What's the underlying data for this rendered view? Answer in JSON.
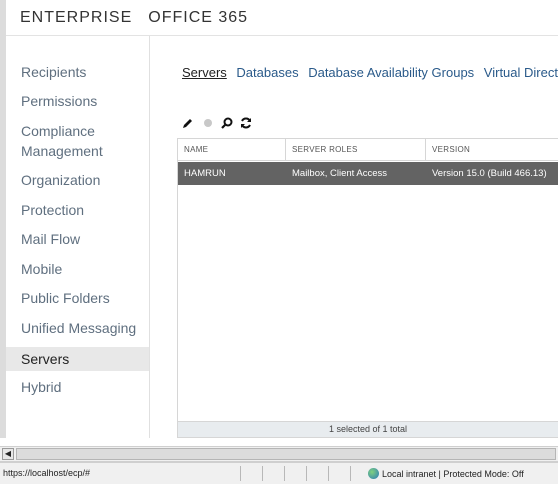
{
  "header": {
    "brand_1": "ENTERPRISE",
    "brand_2": "OFFICE 365"
  },
  "sidebar": {
    "items": [
      {
        "label": "Recipients"
      },
      {
        "label": "Permissions"
      },
      {
        "label": "Compliance\nManagement"
      },
      {
        "label": "Organization"
      },
      {
        "label": "Protection"
      },
      {
        "label": "Mail Flow"
      },
      {
        "label": "Mobile"
      },
      {
        "label": "Public Folders"
      },
      {
        "label": "Unified Messaging"
      },
      {
        "label": "Servers",
        "active": true
      },
      {
        "label": "Hybrid"
      }
    ]
  },
  "tabs": [
    {
      "label": "Servers",
      "active": true
    },
    {
      "label": "Databases"
    },
    {
      "label": "Database Availability Groups"
    },
    {
      "label": "Virtual Directories"
    }
  ],
  "toolbar": {
    "edit_icon": "pencil-icon",
    "disabled_icon": "dot-icon",
    "search_icon": "search-icon",
    "refresh_icon": "refresh-icon"
  },
  "grid": {
    "columns": [
      "NAME",
      "SERVER ROLES",
      "VERSION"
    ],
    "rows": [
      {
        "name": "HAMRUN",
        "roles": "Mailbox, Client Access",
        "version": "Version 15.0 (Build 466.13)",
        "selected": true
      }
    ],
    "footer": "1 selected of 1 total"
  },
  "statusbar": {
    "url": "https://localhost/ecp/#",
    "zone": "Local intranet | Protected Mode: Off"
  },
  "colors": {
    "selected_row": "#636363",
    "link": "#2a5a8a",
    "nav": "#5f6f7f"
  }
}
